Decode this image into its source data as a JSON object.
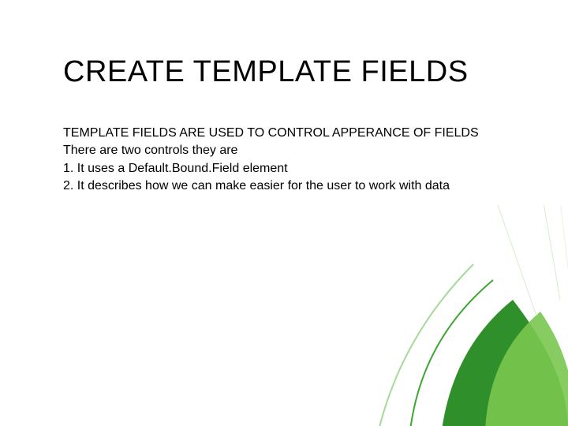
{
  "slide": {
    "title": "CREATE TEMPLATE FIELDS",
    "line1": "TEMPLATE FIELDS ARE USED TO CONTROL APPERANCE OF FIELDS",
    "line2": "There are two controls they are",
    "line3": "1. It uses a Default.Bound.Field element",
    "line4": "2. It describes how we can make easier for the user to work with data"
  },
  "colors": {
    "accent": "#3fa535",
    "accentLight": "#8fce6a"
  }
}
